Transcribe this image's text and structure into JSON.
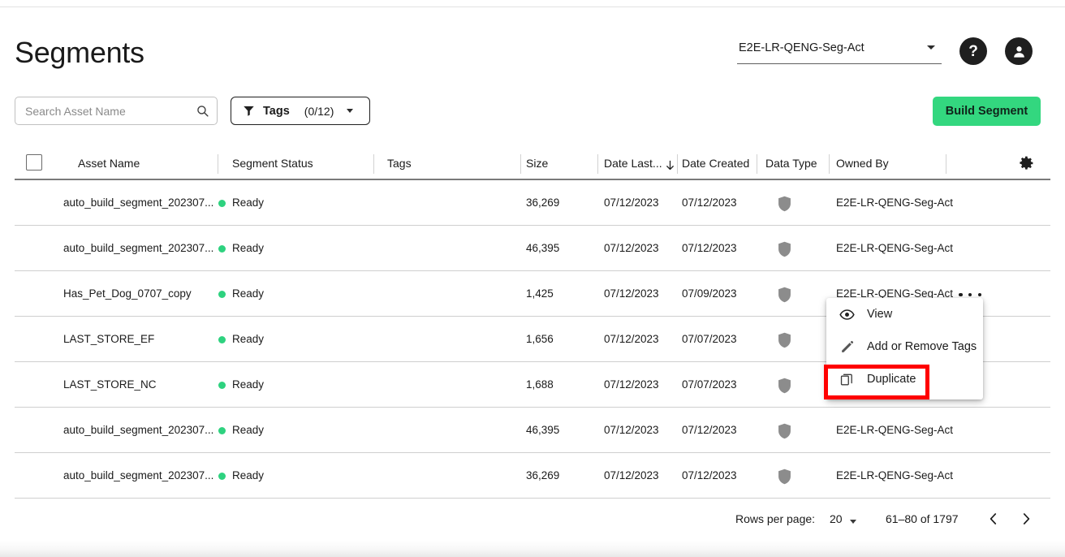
{
  "page": {
    "title": "Segments"
  },
  "header": {
    "account_select": {
      "value": "E2E-LR-QENG-Seg-Act",
      "caret_icon": "chevron-down-icon"
    },
    "help_icon": "question-mark-icon",
    "help_glyph": "?",
    "user_icon": "user-avatar-icon"
  },
  "toolbar": {
    "search": {
      "placeholder": "Search Asset Name",
      "value": "",
      "icon": "search-icon"
    },
    "tags_filter": {
      "icon": "filter-funnel-icon",
      "label": "Tags",
      "count": "(0/12)",
      "caret_icon": "chevron-down-icon"
    },
    "build_button": {
      "label": "Build Segment",
      "color": "#33d77f"
    }
  },
  "table": {
    "select_all_checkbox": "unchecked",
    "settings_icon": "gear-icon",
    "columns": [
      {
        "key": "asset_name",
        "label": "Asset Name"
      },
      {
        "key": "segment_status",
        "label": "Segment Status"
      },
      {
        "key": "tags",
        "label": "Tags"
      },
      {
        "key": "size",
        "label": "Size"
      },
      {
        "key": "date_last",
        "label": "Date Last...",
        "sort": "desc",
        "sort_icon": "arrow-down-icon"
      },
      {
        "key": "date_created",
        "label": "Date Created"
      },
      {
        "key": "data_type",
        "label": "Data Type"
      },
      {
        "key": "owned_by",
        "label": "Owned By"
      }
    ],
    "status_color": "#2ed27f",
    "rows": [
      {
        "asset_name": "auto_build_segment_202307...",
        "segment_status": "Ready",
        "tags": "",
        "size": "36,269",
        "date_last": "07/12/2023",
        "date_created": "07/12/2023",
        "data_type": "shield-icon",
        "owned_by": "E2E-LR-QENG-Seg-Act",
        "menu_open": false
      },
      {
        "asset_name": "auto_build_segment_202307...",
        "segment_status": "Ready",
        "tags": "",
        "size": "46,395",
        "date_last": "07/12/2023",
        "date_created": "07/12/2023",
        "data_type": "shield-icon",
        "owned_by": "E2E-LR-QENG-Seg-Act",
        "menu_open": false
      },
      {
        "asset_name": "Has_Pet_Dog_0707_copy",
        "segment_status": "Ready",
        "tags": "",
        "size": "1,425",
        "date_last": "07/12/2023",
        "date_created": "07/09/2023",
        "data_type": "shield-icon",
        "owned_by": "E2E-LR-QENG-Seg-Act",
        "menu_open": true
      },
      {
        "asset_name": "LAST_STORE_EF",
        "segment_status": "Ready",
        "tags": "",
        "size": "1,656",
        "date_last": "07/12/2023",
        "date_created": "07/07/2023",
        "data_type": "shield-icon",
        "owned_by": "",
        "menu_open": false
      },
      {
        "asset_name": "LAST_STORE_NC",
        "segment_status": "Ready",
        "tags": "",
        "size": "1,688",
        "date_last": "07/12/2023",
        "date_created": "07/07/2023",
        "data_type": "shield-icon",
        "owned_by": "",
        "menu_open": false
      },
      {
        "asset_name": "auto_build_segment_202307...",
        "segment_status": "Ready",
        "tags": "",
        "size": "46,395",
        "date_last": "07/12/2023",
        "date_created": "07/12/2023",
        "data_type": "shield-icon",
        "owned_by": "E2E-LR-QENG-Seg-Act",
        "menu_open": false
      },
      {
        "asset_name": "auto_build_segment_202307...",
        "segment_status": "Ready",
        "tags": "",
        "size": "36,269",
        "date_last": "07/12/2023",
        "date_created": "07/12/2023",
        "data_type": "shield-icon",
        "owned_by": "E2E-LR-QENG-Seg-Act",
        "menu_open": false
      }
    ]
  },
  "context_menu": {
    "items": [
      {
        "label": "View",
        "icon": "eye-icon",
        "highlighted": false
      },
      {
        "label": "Add or Remove Tags",
        "icon": "pencil-icon",
        "highlighted": false
      },
      {
        "label": "Duplicate",
        "icon": "duplicate-icon",
        "highlighted": true
      }
    ],
    "highlight_color": "#ff0000"
  },
  "pagination": {
    "rows_per_page_label": "Rows per page:",
    "rows_per_page_value": "20",
    "range": "61–80 of 1797",
    "prev_icon": "chevron-left-icon",
    "next_icon": "chevron-right-icon",
    "prev_glyph": "‹",
    "next_glyph": "›"
  }
}
